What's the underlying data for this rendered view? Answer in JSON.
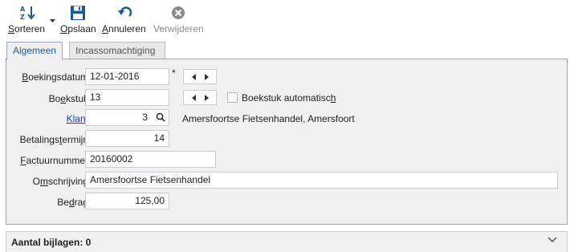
{
  "toolbar": {
    "sort": {
      "label": "Sorteren",
      "icon": "sort-az-icon"
    },
    "save": {
      "label": "Opslaan",
      "icon": "floppy-disk-icon"
    },
    "cancel": {
      "label": "Annuleren",
      "icon": "undo-icon"
    },
    "delete": {
      "label": "Verwijderen",
      "icon": "delete-circle-icon",
      "disabled": true
    }
  },
  "tabs": [
    {
      "label": "Algemeen",
      "active": true
    },
    {
      "label": "Incassomachtiging",
      "active": false
    }
  ],
  "form": {
    "boekingsdatum": {
      "label": "Boekingsdatum",
      "value": "12-01-2016",
      "required_mark": "*"
    },
    "boekstuk": {
      "label": "Boekstuk",
      "value": "13",
      "auto_label": "Boekstuk automatisch",
      "auto_checked": false
    },
    "klant": {
      "label": "Klant",
      "value": "3",
      "name": "Amersfoortse Fietsenhandel, Amersfoort"
    },
    "betalingstermijn": {
      "label": "Betalingstermijn",
      "value": "14"
    },
    "factuurnummer": {
      "label": "Factuurnummer",
      "value": "20160002"
    },
    "omschrijving": {
      "label": "Omschrijving",
      "value": "Amersfoortse Fietsenhandel"
    },
    "bedrag": {
      "label": "Bedrag",
      "value": "125,00"
    }
  },
  "attachments": {
    "title": "Aantal bijlagen: 0"
  },
  "colors": {
    "accent": "#1a5a9c",
    "link": "#1a3cc7",
    "panel_bg": "#f0f0f0",
    "border": "#9aa6b3"
  }
}
